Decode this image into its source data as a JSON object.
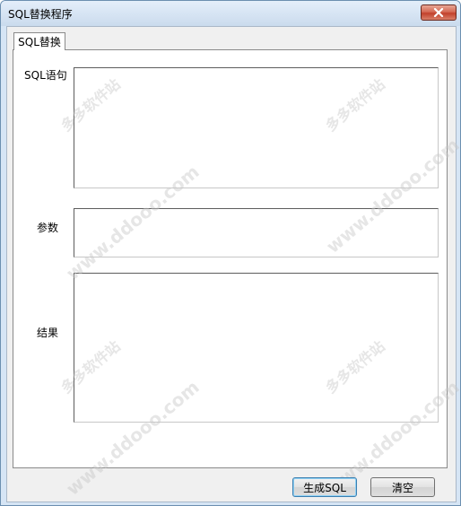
{
  "window": {
    "title": "SQL替换程序"
  },
  "tabs": [
    {
      "label": "SQL替换",
      "selected": true
    }
  ],
  "form": {
    "sql_label": "SQL语句",
    "sql_value": "",
    "params_label": "参数",
    "params_value": "",
    "result_label": "结果",
    "result_value": ""
  },
  "buttons": {
    "generate_label": "生成SQL",
    "clear_label": "清空"
  },
  "watermark": {
    "site": "www.ddooo.com",
    "brand": "多多软件站"
  },
  "colors": {
    "close_button": "#c2412b",
    "title_bar": "#cadbed",
    "dialog_bg": "#f0f0f0"
  },
  "icons": {
    "close": "close-icon"
  }
}
